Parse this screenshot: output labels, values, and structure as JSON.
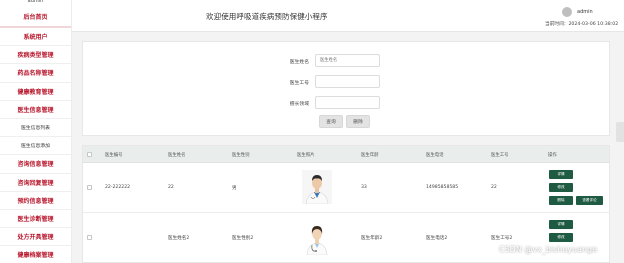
{
  "sidebar": {
    "top_text": "admin",
    "items": [
      {
        "label": "后台首页",
        "type": "home"
      },
      {
        "label": "系统用户",
        "type": "item"
      },
      {
        "label": "疾病类型管理",
        "type": "item"
      },
      {
        "label": "药品名称管理",
        "type": "item"
      },
      {
        "label": "健康教育管理",
        "type": "item"
      },
      {
        "label": "医生信息管理",
        "type": "item"
      },
      {
        "label": "医生信息列表",
        "type": "sub"
      },
      {
        "label": "医生信息添加",
        "type": "sub"
      },
      {
        "label": "咨询信息管理",
        "type": "item"
      },
      {
        "label": "咨询回复管理",
        "type": "item"
      },
      {
        "label": "预约信息管理",
        "type": "item"
      },
      {
        "label": "医生诊断管理",
        "type": "item"
      },
      {
        "label": "处方开具管理",
        "type": "item"
      },
      {
        "label": "健康档案管理",
        "type": "item"
      }
    ]
  },
  "header": {
    "title": "欢迎使用呼吸道疾病预防保健小程序",
    "username": "admin",
    "time_text": "当前时间：2024-03-06 10:38:02"
  },
  "search": {
    "fields": [
      {
        "label": "医生姓名",
        "placeholder": "医生姓名"
      },
      {
        "label": "医生工号",
        "placeholder": ""
      },
      {
        "label": "擅长领域",
        "placeholder": ""
      }
    ],
    "query_label": "查询",
    "delete_label": "删除"
  },
  "table": {
    "headers": [
      "医生编号",
      "医生姓名",
      "医生性别",
      "医生照片",
      "医生年龄",
      "医生电话",
      "医生工号",
      "操作"
    ],
    "rows": [
      {
        "id": "22-222222",
        "name": "22",
        "gender": "男",
        "age": "33",
        "phone": "14985858585",
        "job_no": "22",
        "actions": [
          "详情",
          "修改",
          "删除",
          "查看评论"
        ]
      },
      {
        "id": "",
        "name": "医生姓名2",
        "gender": "医生性别2",
        "age": "医生年龄2",
        "phone": "医生电话2",
        "job_no": "医生工号2",
        "actions": [
          "详情",
          "修改"
        ]
      }
    ]
  },
  "watermark": "CSDN @vx_bisheyuange",
  "colors": {
    "accent": "#b8142a",
    "action_button": "#1f5b43",
    "table_header": "#e9eeed"
  }
}
